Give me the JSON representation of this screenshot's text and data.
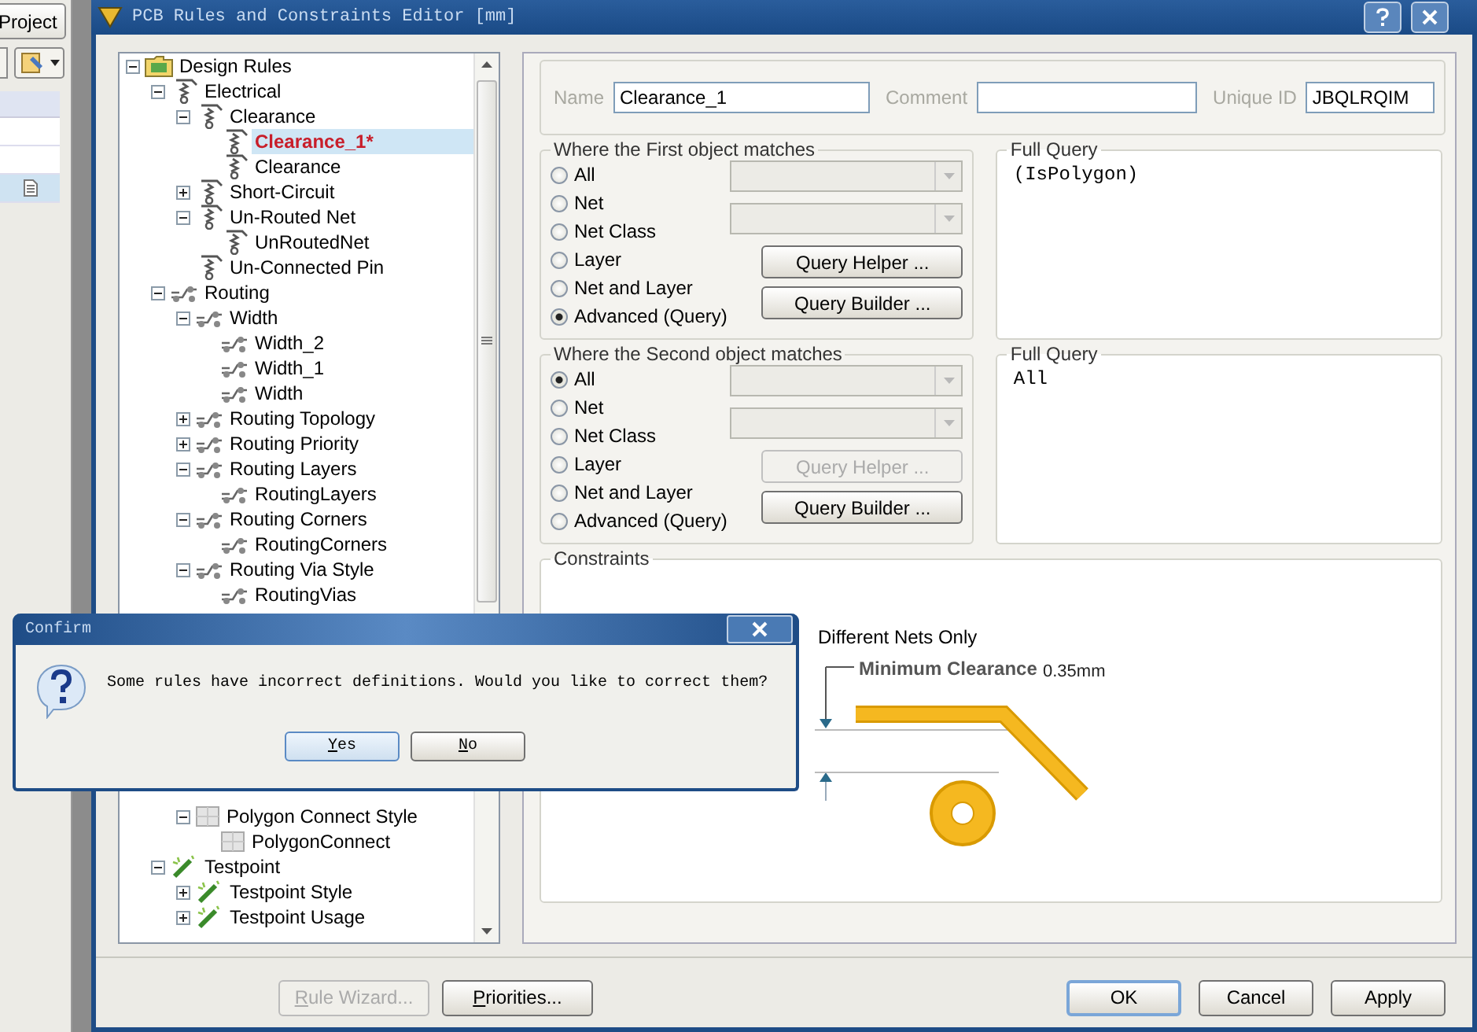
{
  "background_window": {
    "button": "Project"
  },
  "window": {
    "title": "PCB Rules and Constraints Editor [mm]"
  },
  "tree": {
    "items": [
      {
        "label": "Design Rules",
        "kind": "root",
        "expanded": true,
        "selected": false,
        "children": [
          {
            "label": "Electrical",
            "kind": "electrical",
            "expanded": true,
            "selected": false,
            "children": [
              {
                "label": "Clearance",
                "kind": "electrical",
                "expanded": true,
                "selected": false,
                "children": [
                  {
                    "label": "Clearance_1*",
                    "kind": "electrical",
                    "selected": true
                  },
                  {
                    "label": "Clearance",
                    "kind": "electrical",
                    "selected": false
                  }
                ]
              },
              {
                "label": "Short-Circuit",
                "kind": "electrical",
                "expanded": false,
                "selected": false
              },
              {
                "label": "Un-Routed Net",
                "kind": "electrical",
                "expanded": true,
                "selected": false,
                "children": [
                  {
                    "label": "UnRoutedNet",
                    "kind": "electrical",
                    "selected": false
                  }
                ]
              },
              {
                "label": "Un-Connected Pin",
                "kind": "electrical",
                "selected": false
              }
            ]
          },
          {
            "label": "Routing",
            "kind": "routing",
            "expanded": true,
            "selected": false,
            "children": [
              {
                "label": "Width",
                "kind": "routing",
                "expanded": true,
                "selected": false,
                "children": [
                  {
                    "label": "Width_2",
                    "kind": "routing",
                    "selected": false
                  },
                  {
                    "label": "Width_1",
                    "kind": "routing",
                    "selected": false
                  },
                  {
                    "label": "Width",
                    "kind": "routing",
                    "selected": false
                  }
                ]
              },
              {
                "label": "Routing Topology",
                "kind": "routing",
                "expanded": false,
                "selected": false
              },
              {
                "label": "Routing Priority",
                "kind": "routing",
                "expanded": false,
                "selected": false
              },
              {
                "label": "Routing Layers",
                "kind": "routing",
                "expanded": true,
                "selected": false,
                "children": [
                  {
                    "label": "RoutingLayers",
                    "kind": "routing",
                    "selected": false
                  }
                ]
              },
              {
                "label": "Routing Corners",
                "kind": "routing",
                "expanded": true,
                "selected": false,
                "children": [
                  {
                    "label": "RoutingCorners",
                    "kind": "routing",
                    "selected": false
                  }
                ]
              },
              {
                "label": "Routing Via Style",
                "kind": "routing",
                "expanded": true,
                "selected": false,
                "children": [
                  {
                    "label": "RoutingVias",
                    "kind": "routing",
                    "selected": false
                  }
                ]
              }
            ]
          }
        ]
      }
    ],
    "after_dialog": {
      "nested_items": [
        {
          "label": "Polygon Connect Style",
          "kind": "plane",
          "expanded": true,
          "selected": false,
          "children": [
            {
              "label": "PolygonConnect",
              "kind": "plane",
              "selected": false
            }
          ]
        }
      ],
      "items": [
        {
          "label": "Testpoint",
          "kind": "testpoint",
          "expanded": true,
          "selected": false,
          "children": [
            {
              "label": "Testpoint Style",
              "kind": "testpoint",
              "expanded": false,
              "selected": false
            },
            {
              "label": "Testpoint Usage",
              "kind": "testpoint",
              "expanded": false,
              "selected": false
            }
          ]
        }
      ]
    }
  },
  "rule": {
    "name_label": "Name",
    "name": "Clearance_1",
    "comment_label": "Comment",
    "unique_id_label": "Unique ID",
    "unique_id": "JBQLRQIM"
  },
  "first_object": {
    "title": "Where the First object matches",
    "options": [
      {
        "label": "All",
        "selected": false
      },
      {
        "label": "Net",
        "selected": false
      },
      {
        "label": "Net Class",
        "selected": false
      },
      {
        "label": "Layer",
        "selected": false
      },
      {
        "label": "Net and Layer",
        "selected": false
      },
      {
        "label": "Advanced (Query)",
        "selected": true
      }
    ],
    "dropdowns": [
      {
        "disabled": true
      },
      {
        "disabled": true
      }
    ],
    "buttons": [
      {
        "label": "Query Helper ...",
        "disabled": false
      },
      {
        "label": "Query Builder ...",
        "disabled": false
      }
    ],
    "query_title": "Full Query",
    "query": "(IsPolygon)"
  },
  "second_object": {
    "title": "Where the Second object matches",
    "options": [
      {
        "label": "All",
        "selected": true
      },
      {
        "label": "Net",
        "selected": false
      },
      {
        "label": "Net Class",
        "selected": false
      },
      {
        "label": "Layer",
        "selected": false
      },
      {
        "label": "Net and Layer",
        "selected": false
      },
      {
        "label": "Advanced (Query)",
        "selected": false
      }
    ],
    "dropdowns": [
      {
        "disabled": true
      },
      {
        "disabled": true
      }
    ],
    "buttons": [
      {
        "label": "Query Helper ...",
        "disabled": true
      },
      {
        "label": "Query Builder ...",
        "disabled": false
      }
    ],
    "query_title": "Full Query",
    "query": "All"
  },
  "constraints": {
    "title": "Constraints",
    "scope": "Different Nets Only",
    "clearance_label": "Minimum Clearance",
    "clearance_value": "0.35mm"
  },
  "footer": {
    "buttons": [
      {
        "label": "Rule Wizard...",
        "disabled": true,
        "default": false
      },
      {
        "label": "Priorities...",
        "disabled": false,
        "default": false
      }
    ],
    "actions": [
      {
        "label": "OK",
        "disabled": false,
        "default": true
      },
      {
        "label": "Cancel",
        "disabled": false,
        "default": false
      },
      {
        "label": "Apply",
        "disabled": false,
        "default": false
      }
    ]
  },
  "dialog": {
    "title": "Confirm",
    "message": "Some rules have incorrect definitions. Would you like to correct them?",
    "buttons": [
      {
        "label": "Yes",
        "default": true
      },
      {
        "label": "No",
        "default": false
      }
    ]
  }
}
